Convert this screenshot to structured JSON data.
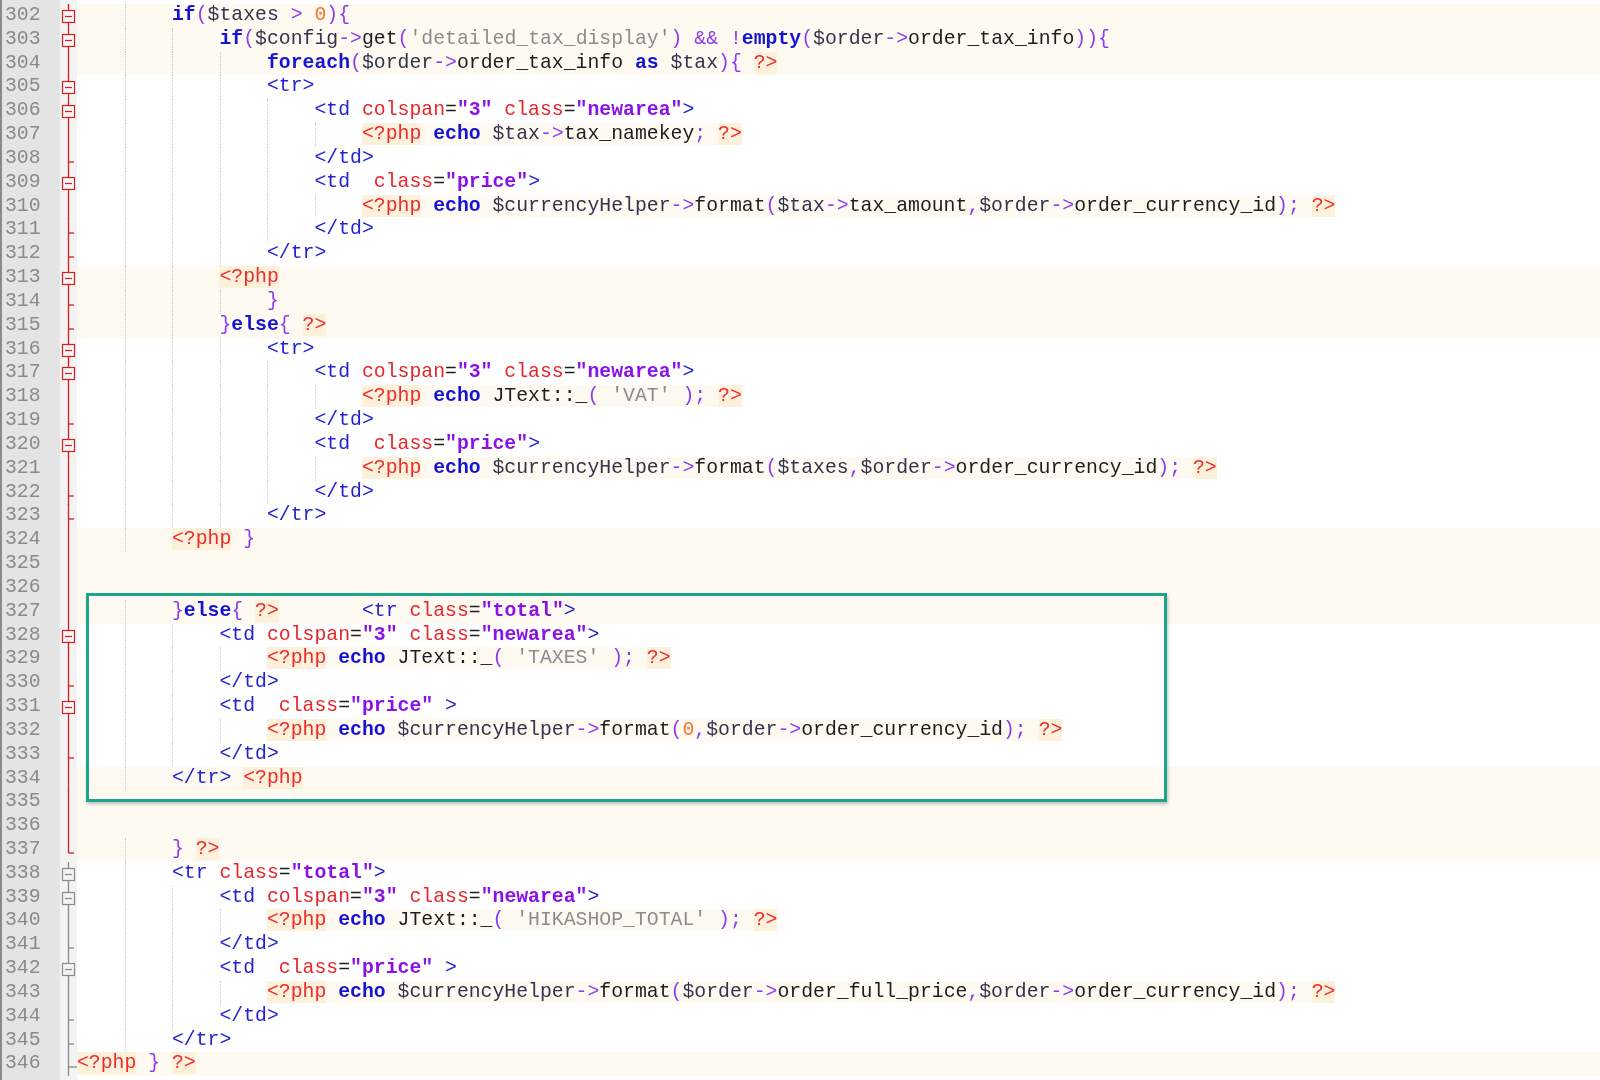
{
  "editor": {
    "lines": [
      {
        "number": "302",
        "fold_start": true,
        "fold_end": false,
        "fold_active": true,
        "php_mode": true,
        "boxed": false,
        "tokens": [
          {
            "kind": "kw",
            "text": "        if"
          },
          {
            "kind": "op",
            "text": "("
          },
          {
            "kind": "var",
            "text": "$taxes"
          },
          {
            "kind": "op",
            "text": " >"
          },
          {
            "kind": "num",
            "text": " 0"
          },
          {
            "kind": "op",
            "text": "){"
          }
        ]
      },
      {
        "number": "303",
        "fold_start": true,
        "fold_end": false,
        "fold_active": true,
        "php_mode": true,
        "boxed": false,
        "tokens": [
          {
            "kind": "kw",
            "text": "            if"
          },
          {
            "kind": "op",
            "text": "("
          },
          {
            "kind": "var",
            "text": "$config"
          },
          {
            "kind": "op",
            "text": "->"
          },
          {
            "kind": "ident",
            "text": "get"
          },
          {
            "kind": "op",
            "text": "("
          },
          {
            "kind": "str",
            "text": "'detailed_tax_display'"
          },
          {
            "kind": "op",
            "text": ")"
          },
          {
            "kind": "op",
            "text": " &&"
          },
          {
            "kind": "op",
            "text": " !"
          },
          {
            "kind": "kw",
            "text": "empty"
          },
          {
            "kind": "op",
            "text": "("
          },
          {
            "kind": "var",
            "text": "$order"
          },
          {
            "kind": "op",
            "text": "->"
          },
          {
            "kind": "ident",
            "text": "order_tax_info"
          },
          {
            "kind": "op",
            "text": ")){"
          }
        ]
      },
      {
        "number": "304",
        "fold_start": false,
        "fold_end": false,
        "fold_active": true,
        "php_mode": true,
        "boxed": false,
        "tokens": [
          {
            "kind": "kw",
            "text": "                foreach"
          },
          {
            "kind": "op",
            "text": "("
          },
          {
            "kind": "var",
            "text": "$order"
          },
          {
            "kind": "op",
            "text": "->"
          },
          {
            "kind": "ident",
            "text": "order_tax_info"
          },
          {
            "kind": "kw",
            "text": " as"
          },
          {
            "kind": "var",
            "text": " $tax"
          },
          {
            "kind": "op",
            "text": "){"
          },
          {
            "kind": "php",
            "text": " ?>"
          }
        ]
      },
      {
        "number": "305",
        "fold_start": true,
        "fold_end": false,
        "fold_active": true,
        "php_mode": false,
        "boxed": false,
        "tokens": [
          {
            "kind": "tag",
            "text": "                <tr>"
          }
        ]
      },
      {
        "number": "306",
        "fold_start": true,
        "fold_end": false,
        "fold_active": true,
        "php_mode": false,
        "boxed": false,
        "tokens": [
          {
            "kind": "tag",
            "text": "                    <td"
          },
          {
            "kind": "attr",
            "text": " colspan"
          },
          {
            "kind": "eq",
            "text": "="
          },
          {
            "kind": "val",
            "text": "\"3\""
          },
          {
            "kind": "attr",
            "text": " class"
          },
          {
            "kind": "eq",
            "text": "="
          },
          {
            "kind": "val",
            "text": "\"newarea\""
          },
          {
            "kind": "tag",
            "text": ">"
          }
        ]
      },
      {
        "number": "307",
        "fold_start": false,
        "fold_end": false,
        "fold_active": true,
        "php_mode": false,
        "boxed": false,
        "tokens": [
          {
            "kind": "embed",
            "tokens": [
              {
                "kind": "php",
                "text": "                        <?php"
              },
              {
                "kind": "kw",
                "text": " echo"
              },
              {
                "kind": "var",
                "text": " $tax"
              },
              {
                "kind": "op",
                "text": "->"
              },
              {
                "kind": "ident",
                "text": "tax_namekey"
              },
              {
                "kind": "op",
                "text": ";"
              },
              {
                "kind": "php",
                "text": " ?>"
              }
            ]
          }
        ]
      },
      {
        "number": "308",
        "fold_start": false,
        "fold_end": true,
        "fold_active": true,
        "php_mode": false,
        "boxed": false,
        "tokens": [
          {
            "kind": "tag",
            "text": "                    </td>"
          }
        ]
      },
      {
        "number": "309",
        "fold_start": true,
        "fold_end": false,
        "fold_active": true,
        "php_mode": false,
        "boxed": false,
        "tokens": [
          {
            "kind": "tag",
            "text": "                    <td"
          },
          {
            "kind": "attr",
            "text": "  class"
          },
          {
            "kind": "eq",
            "text": "="
          },
          {
            "kind": "val",
            "text": "\"price\""
          },
          {
            "kind": "tag",
            "text": ">"
          }
        ]
      },
      {
        "number": "310",
        "fold_start": false,
        "fold_end": false,
        "fold_active": true,
        "php_mode": false,
        "boxed": false,
        "tokens": [
          {
            "kind": "embed",
            "tokens": [
              {
                "kind": "php",
                "text": "                        <?php"
              },
              {
                "kind": "kw",
                "text": " echo"
              },
              {
                "kind": "var",
                "text": " $currencyHelper"
              },
              {
                "kind": "op",
                "text": "->"
              },
              {
                "kind": "ident",
                "text": "format"
              },
              {
                "kind": "op",
                "text": "("
              },
              {
                "kind": "var",
                "text": "$tax"
              },
              {
                "kind": "op",
                "text": "->"
              },
              {
                "kind": "ident",
                "text": "tax_amount"
              },
              {
                "kind": "op",
                "text": ","
              },
              {
                "kind": "var",
                "text": "$order"
              },
              {
                "kind": "op",
                "text": "->"
              },
              {
                "kind": "ident",
                "text": "order_currency_id"
              },
              {
                "kind": "op",
                "text": ");"
              },
              {
                "kind": "php",
                "text": " ?>"
              }
            ]
          }
        ]
      },
      {
        "number": "311",
        "fold_start": false,
        "fold_end": true,
        "fold_active": true,
        "php_mode": false,
        "boxed": false,
        "tokens": [
          {
            "kind": "tag",
            "text": "                    </td>"
          }
        ]
      },
      {
        "number": "312",
        "fold_start": false,
        "fold_end": true,
        "fold_active": true,
        "php_mode": false,
        "boxed": false,
        "tokens": [
          {
            "kind": "tag",
            "text": "                </tr>"
          }
        ]
      },
      {
        "number": "313",
        "fold_start": true,
        "fold_end": false,
        "fold_active": true,
        "php_mode": true,
        "boxed": false,
        "tokens": [
          {
            "kind": "php",
            "text": "            <?php"
          }
        ]
      },
      {
        "number": "314",
        "fold_start": false,
        "fold_end": true,
        "fold_active": true,
        "php_mode": true,
        "boxed": false,
        "tokens": [
          {
            "kind": "op",
            "text": "                }"
          }
        ]
      },
      {
        "number": "315",
        "fold_start": false,
        "fold_end": true,
        "fold_active": true,
        "php_mode": true,
        "boxed": false,
        "tokens": [
          {
            "kind": "op",
            "text": "            }"
          },
          {
            "kind": "kw",
            "text": "else"
          },
          {
            "kind": "op",
            "text": "{"
          },
          {
            "kind": "php",
            "text": " ?>"
          }
        ]
      },
      {
        "number": "316",
        "fold_start": true,
        "fold_end": false,
        "fold_active": true,
        "php_mode": false,
        "boxed": false,
        "tokens": [
          {
            "kind": "tag",
            "text": "                <tr>"
          }
        ]
      },
      {
        "number": "317",
        "fold_start": true,
        "fold_end": false,
        "fold_active": true,
        "php_mode": false,
        "boxed": false,
        "tokens": [
          {
            "kind": "tag",
            "text": "                    <td"
          },
          {
            "kind": "attr",
            "text": " colspan"
          },
          {
            "kind": "eq",
            "text": "="
          },
          {
            "kind": "val",
            "text": "\"3\""
          },
          {
            "kind": "attr",
            "text": " class"
          },
          {
            "kind": "eq",
            "text": "="
          },
          {
            "kind": "val",
            "text": "\"newarea\""
          },
          {
            "kind": "tag",
            "text": ">"
          }
        ]
      },
      {
        "number": "318",
        "fold_start": false,
        "fold_end": false,
        "fold_active": true,
        "php_mode": false,
        "boxed": false,
        "tokens": [
          {
            "kind": "embed",
            "tokens": [
              {
                "kind": "php",
                "text": "                        <?php"
              },
              {
                "kind": "kw",
                "text": " echo"
              },
              {
                "kind": "ident",
                "text": " JText::_"
              },
              {
                "kind": "op",
                "text": "("
              },
              {
                "kind": "str",
                "text": " 'VAT'"
              },
              {
                "kind": "op",
                "text": " );"
              },
              {
                "kind": "php",
                "text": " ?>"
              }
            ]
          }
        ]
      },
      {
        "number": "319",
        "fold_start": false,
        "fold_end": true,
        "fold_active": true,
        "php_mode": false,
        "boxed": false,
        "tokens": [
          {
            "kind": "tag",
            "text": "                    </td>"
          }
        ]
      },
      {
        "number": "320",
        "fold_start": true,
        "fold_end": false,
        "fold_active": true,
        "php_mode": false,
        "boxed": false,
        "tokens": [
          {
            "kind": "tag",
            "text": "                    <td"
          },
          {
            "kind": "attr",
            "text": "  class"
          },
          {
            "kind": "eq",
            "text": "="
          },
          {
            "kind": "val",
            "text": "\"price\""
          },
          {
            "kind": "tag",
            "text": ">"
          }
        ]
      },
      {
        "number": "321",
        "fold_start": false,
        "fold_end": false,
        "fold_active": true,
        "php_mode": false,
        "boxed": false,
        "tokens": [
          {
            "kind": "embed",
            "tokens": [
              {
                "kind": "php",
                "text": "                        <?php"
              },
              {
                "kind": "kw",
                "text": " echo"
              },
              {
                "kind": "var",
                "text": " $currencyHelper"
              },
              {
                "kind": "op",
                "text": "->"
              },
              {
                "kind": "ident",
                "text": "format"
              },
              {
                "kind": "op",
                "text": "("
              },
              {
                "kind": "var",
                "text": "$taxes"
              },
              {
                "kind": "op",
                "text": ","
              },
              {
                "kind": "var",
                "text": "$order"
              },
              {
                "kind": "op",
                "text": "->"
              },
              {
                "kind": "ident",
                "text": "order_currency_id"
              },
              {
                "kind": "op",
                "text": ");"
              },
              {
                "kind": "php",
                "text": " ?>"
              }
            ]
          }
        ]
      },
      {
        "number": "322",
        "fold_start": false,
        "fold_end": true,
        "fold_active": true,
        "php_mode": false,
        "boxed": false,
        "tokens": [
          {
            "kind": "tag",
            "text": "                    </td>"
          }
        ]
      },
      {
        "number": "323",
        "fold_start": false,
        "fold_end": true,
        "fold_active": true,
        "php_mode": false,
        "boxed": false,
        "tokens": [
          {
            "kind": "tag",
            "text": "                </tr>"
          }
        ]
      },
      {
        "number": "324",
        "fold_start": false,
        "fold_end": false,
        "fold_active": true,
        "php_mode": true,
        "boxed": false,
        "tokens": [
          {
            "kind": "php",
            "text": "        <?php"
          },
          {
            "kind": "op",
            "text": " }"
          }
        ]
      },
      {
        "number": "325",
        "fold_start": false,
        "fold_end": false,
        "fold_active": true,
        "php_mode": true,
        "boxed": false
      },
      {
        "number": "326",
        "fold_start": false,
        "fold_end": false,
        "fold_active": true,
        "php_mode": true,
        "boxed": false
      },
      {
        "number": "327",
        "fold_start": false,
        "fold_end": false,
        "fold_active": true,
        "php_mode": true,
        "boxed": true,
        "tokens": [
          {
            "kind": "op",
            "text": "        }"
          },
          {
            "kind": "kw",
            "text": "else"
          },
          {
            "kind": "op",
            "text": "{"
          },
          {
            "kind": "php",
            "text": " ?>"
          },
          {
            "kind": "tag",
            "text": "       <tr"
          },
          {
            "kind": "attr",
            "text": " class"
          },
          {
            "kind": "eq",
            "text": "="
          },
          {
            "kind": "val",
            "text": "\"total\""
          },
          {
            "kind": "tag",
            "text": ">"
          }
        ]
      },
      {
        "number": "328",
        "fold_start": true,
        "fold_end": false,
        "fold_active": true,
        "php_mode": false,
        "boxed": true,
        "tokens": [
          {
            "kind": "tag",
            "text": "            <td"
          },
          {
            "kind": "attr",
            "text": " colspan"
          },
          {
            "kind": "eq",
            "text": "="
          },
          {
            "kind": "val",
            "text": "\"3\""
          },
          {
            "kind": "attr",
            "text": " class"
          },
          {
            "kind": "eq",
            "text": "="
          },
          {
            "kind": "val",
            "text": "\"newarea\""
          },
          {
            "kind": "tag",
            "text": ">"
          }
        ]
      },
      {
        "number": "329",
        "fold_start": false,
        "fold_end": false,
        "fold_active": true,
        "php_mode": false,
        "boxed": true,
        "tokens": [
          {
            "kind": "embed",
            "tokens": [
              {
                "kind": "php",
                "text": "                <?php"
              },
              {
                "kind": "kw",
                "text": " echo"
              },
              {
                "kind": "ident",
                "text": " JText::_"
              },
              {
                "kind": "op",
                "text": "("
              },
              {
                "kind": "str",
                "text": " 'TAXES'"
              },
              {
                "kind": "op",
                "text": " );"
              },
              {
                "kind": "php",
                "text": " ?>"
              }
            ]
          }
        ]
      },
      {
        "number": "330",
        "fold_start": false,
        "fold_end": true,
        "fold_active": true,
        "php_mode": false,
        "boxed": true,
        "tokens": [
          {
            "kind": "tag",
            "text": "            </td>"
          }
        ]
      },
      {
        "number": "331",
        "fold_start": true,
        "fold_end": false,
        "fold_active": true,
        "php_mode": false,
        "boxed": true,
        "tokens": [
          {
            "kind": "tag",
            "text": "            <td"
          },
          {
            "kind": "attr",
            "text": "  class"
          },
          {
            "kind": "eq",
            "text": "="
          },
          {
            "kind": "val",
            "text": "\"price\""
          },
          {
            "kind": "tag",
            "text": " >"
          }
        ]
      },
      {
        "number": "332",
        "fold_start": false,
        "fold_end": false,
        "fold_active": true,
        "php_mode": false,
        "boxed": true,
        "tokens": [
          {
            "kind": "embed",
            "tokens": [
              {
                "kind": "php",
                "text": "                <?php"
              },
              {
                "kind": "kw",
                "text": " echo"
              },
              {
                "kind": "var",
                "text": " $currencyHelper"
              },
              {
                "kind": "op",
                "text": "->"
              },
              {
                "kind": "ident",
                "text": "format"
              },
              {
                "kind": "op",
                "text": "("
              },
              {
                "kind": "num",
                "text": "0"
              },
              {
                "kind": "op",
                "text": ","
              },
              {
                "kind": "var",
                "text": "$order"
              },
              {
                "kind": "op",
                "text": "->"
              },
              {
                "kind": "ident",
                "text": "order_currency_id"
              },
              {
                "kind": "op",
                "text": ");"
              },
              {
                "kind": "php",
                "text": " ?>"
              }
            ]
          }
        ]
      },
      {
        "number": "333",
        "fold_start": false,
        "fold_end": true,
        "fold_active": true,
        "php_mode": false,
        "boxed": true,
        "tokens": [
          {
            "kind": "tag",
            "text": "            </td>"
          }
        ]
      },
      {
        "number": "334",
        "fold_start": false,
        "fold_end": false,
        "fold_active": true,
        "php_mode": true,
        "boxed": true,
        "tokens": [
          {
            "kind": "tag",
            "text": "        </tr>"
          },
          {
            "kind": "php",
            "text": " <?php"
          }
        ]
      },
      {
        "number": "335",
        "fold_start": false,
        "fold_end": false,
        "fold_active": true,
        "php_mode": true,
        "boxed": false
      },
      {
        "number": "336",
        "fold_start": false,
        "fold_end": false,
        "fold_active": true,
        "php_mode": true,
        "boxed": false
      },
      {
        "number": "337",
        "fold_start": false,
        "fold_end": true,
        "fold_active": true,
        "php_mode": true,
        "boxed": false,
        "tokens": [
          {
            "kind": "op",
            "text": "        }"
          },
          {
            "kind": "php",
            "text": " ?>"
          }
        ]
      },
      {
        "number": "338",
        "fold_start": true,
        "fold_end": false,
        "fold_active": false,
        "php_mode": false,
        "boxed": false,
        "tokens": [
          {
            "kind": "tag",
            "text": "        <tr"
          },
          {
            "kind": "attr",
            "text": " class"
          },
          {
            "kind": "eq",
            "text": "="
          },
          {
            "kind": "val",
            "text": "\"total\""
          },
          {
            "kind": "tag",
            "text": ">"
          }
        ]
      },
      {
        "number": "339",
        "fold_start": true,
        "fold_end": false,
        "fold_active": false,
        "php_mode": false,
        "boxed": false,
        "tokens": [
          {
            "kind": "tag",
            "text": "            <td"
          },
          {
            "kind": "attr",
            "text": " colspan"
          },
          {
            "kind": "eq",
            "text": "="
          },
          {
            "kind": "val",
            "text": "\"3\""
          },
          {
            "kind": "attr",
            "text": " class"
          },
          {
            "kind": "eq",
            "text": "="
          },
          {
            "kind": "val",
            "text": "\"newarea\""
          },
          {
            "kind": "tag",
            "text": ">"
          }
        ]
      },
      {
        "number": "340",
        "fold_start": false,
        "fold_end": false,
        "fold_active": false,
        "php_mode": false,
        "boxed": false,
        "tokens": [
          {
            "kind": "embed",
            "tokens": [
              {
                "kind": "php",
                "text": "                <?php"
              },
              {
                "kind": "kw",
                "text": " echo"
              },
              {
                "kind": "ident",
                "text": " JText::_"
              },
              {
                "kind": "op",
                "text": "("
              },
              {
                "kind": "str",
                "text": " 'HIKASHOP_TOTAL'"
              },
              {
                "kind": "op",
                "text": " );"
              },
              {
                "kind": "php",
                "text": " ?>"
              }
            ]
          }
        ]
      },
      {
        "number": "341",
        "fold_start": false,
        "fold_end": true,
        "fold_active": false,
        "php_mode": false,
        "boxed": false,
        "tokens": [
          {
            "kind": "tag",
            "text": "            </td>"
          }
        ]
      },
      {
        "number": "342",
        "fold_start": true,
        "fold_end": false,
        "fold_active": false,
        "php_mode": false,
        "boxed": false,
        "tokens": [
          {
            "kind": "tag",
            "text": "            <td"
          },
          {
            "kind": "attr",
            "text": "  class"
          },
          {
            "kind": "eq",
            "text": "="
          },
          {
            "kind": "val",
            "text": "\"price\""
          },
          {
            "kind": "tag",
            "text": " >"
          }
        ]
      },
      {
        "number": "343",
        "fold_start": false,
        "fold_end": false,
        "fold_active": false,
        "php_mode": false,
        "boxed": false,
        "tokens": [
          {
            "kind": "embed",
            "tokens": [
              {
                "kind": "php",
                "text": "                <?php"
              },
              {
                "kind": "kw",
                "text": " echo"
              },
              {
                "kind": "var",
                "text": " $currencyHelper"
              },
              {
                "kind": "op",
                "text": "->"
              },
              {
                "kind": "ident",
                "text": "format"
              },
              {
                "kind": "op",
                "text": "("
              },
              {
                "kind": "var",
                "text": "$order"
              },
              {
                "kind": "op",
                "text": "->"
              },
              {
                "kind": "ident",
                "text": "order_full_price"
              },
              {
                "kind": "op",
                "text": ","
              },
              {
                "kind": "var",
                "text": "$order"
              },
              {
                "kind": "op",
                "text": "->"
              },
              {
                "kind": "ident",
                "text": "order_currency_id"
              },
              {
                "kind": "op",
                "text": ");"
              },
              {
                "kind": "php",
                "text": " ?>"
              }
            ]
          }
        ]
      },
      {
        "number": "344",
        "fold_start": false,
        "fold_end": true,
        "fold_active": false,
        "php_mode": false,
        "boxed": false,
        "tokens": [
          {
            "kind": "tag",
            "text": "            </td>"
          }
        ]
      },
      {
        "number": "345",
        "fold_start": false,
        "fold_end": true,
        "fold_active": false,
        "php_mode": false,
        "boxed": false,
        "tokens": [
          {
            "kind": "tag",
            "text": "        </tr>"
          }
        ]
      },
      {
        "number": "346",
        "fold_start": false,
        "fold_end": true,
        "fold_active": false,
        "php_mode": true,
        "boxed": false,
        "tokens": [
          {
            "kind": "php",
            "text": "<?php"
          },
          {
            "kind": "op",
            "text": " }"
          },
          {
            "kind": "php",
            "text": " ?>"
          }
        ]
      }
    ]
  }
}
